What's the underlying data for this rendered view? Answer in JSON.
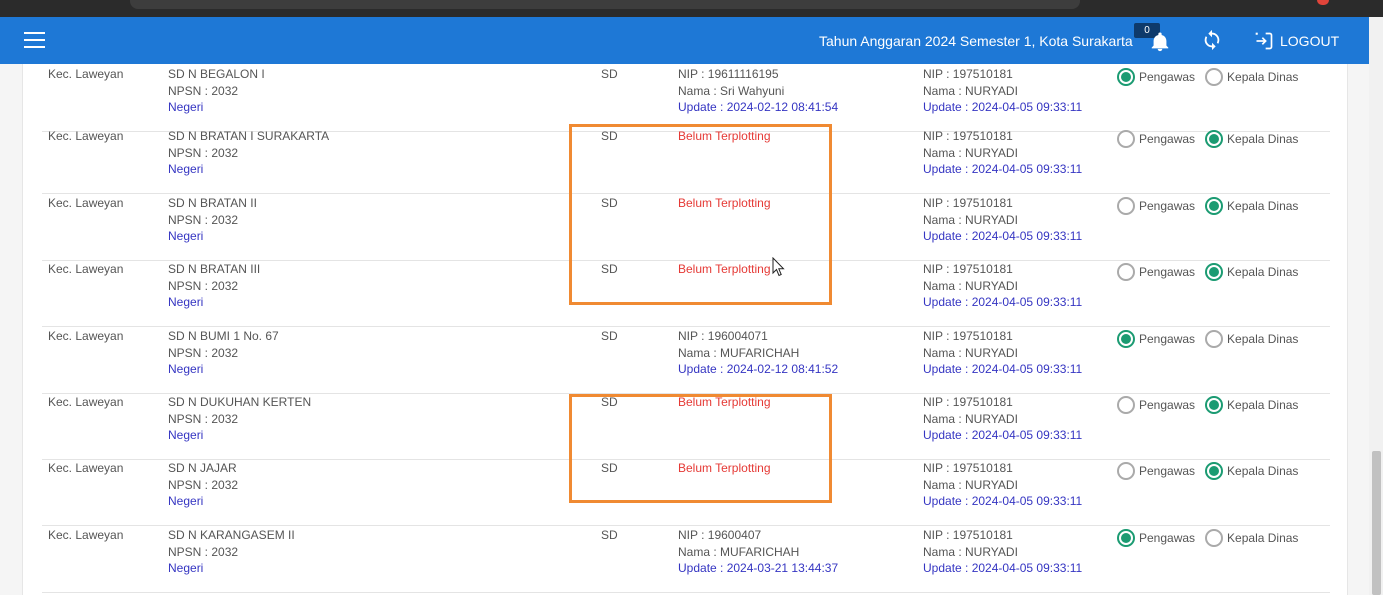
{
  "header": {
    "title": "Tahun Anggaran 2024 Semester 1, Kota Surakarta",
    "notif_count": "0",
    "logout_label": "LOGOUT"
  },
  "radio_labels": {
    "pengawas": "Pengawas",
    "kadis": "Kepala Dinas"
  },
  "rows": [
    {
      "kec": "Kec. Laweyan",
      "school": "SD N BEGALON I",
      "npsn": "NPSN : 2032",
      "status": "Negeri",
      "jenjang": "SD",
      "peng_nip": "NIP : 19611116195",
      "peng_nama": "Nama : Sri Wahyuni",
      "peng_update": "Update : 2024-02-12 08:41:54",
      "kadis_nip": "NIP : 197510181",
      "kadis_nama": "Nama : NURYADI",
      "kadis_update": "Update : 2024-04-05 09:33:11"
    },
    {
      "kec": "Kec. Laweyan",
      "school": "SD N BRATAN I SURAKARTA",
      "npsn": "NPSN : 2032",
      "status": "Negeri",
      "jenjang": "SD",
      "peng_status": "Belum Terplotting",
      "kadis_nip": "NIP : 197510181",
      "kadis_nama": "Nama : NURYADI",
      "kadis_update": "Update : 2024-04-05 09:33:11"
    },
    {
      "kec": "Kec. Laweyan",
      "school": "SD N BRATAN II",
      "npsn": "NPSN : 2032",
      "status": "Negeri",
      "jenjang": "SD",
      "peng_status": "Belum Terplotting",
      "kadis_nip": "NIP : 197510181",
      "kadis_nama": "Nama : NURYADI",
      "kadis_update": "Update : 2024-04-05 09:33:11"
    },
    {
      "kec": "Kec. Laweyan",
      "school": "SD N BRATAN III",
      "npsn": "NPSN : 2032",
      "status": "Negeri",
      "jenjang": "SD",
      "peng_status": "Belum Terplotting",
      "kadis_nip": "NIP : 197510181",
      "kadis_nama": "Nama : NURYADI",
      "kadis_update": "Update : 2024-04-05 09:33:11"
    },
    {
      "kec": "Kec. Laweyan",
      "school": "SD N BUMI 1 No. 67",
      "npsn": "NPSN : 2032",
      "status": "Negeri",
      "jenjang": "SD",
      "peng_nip": "NIP : 196004071",
      "peng_nama": "Nama : MUFARICHAH",
      "peng_update": "Update : 2024-02-12 08:41:52",
      "kadis_nip": "NIP : 197510181",
      "kadis_nama": "Nama : NURYADI",
      "kadis_update": "Update : 2024-04-05 09:33:11"
    },
    {
      "kec": "Kec. Laweyan",
      "school": "SD N DUKUHAN KERTEN",
      "npsn": "NPSN : 2032",
      "status": "Negeri",
      "jenjang": "SD",
      "peng_status": "Belum Terplotting",
      "kadis_nip": "NIP : 197510181",
      "kadis_nama": "Nama : NURYADI",
      "kadis_update": "Update : 2024-04-05 09:33:11"
    },
    {
      "kec": "Kec. Laweyan",
      "school": "SD N JAJAR",
      "npsn": "NPSN : 2032",
      "status": "Negeri",
      "jenjang": "SD",
      "peng_status": "Belum Terplotting",
      "kadis_nip": "NIP : 197510181",
      "kadis_nama": "Nama : NURYADI",
      "kadis_update": "Update : 2024-04-05 09:33:11"
    },
    {
      "kec": "Kec. Laweyan",
      "school": "SD N KARANGASEM II",
      "npsn": "NPSN : 2032",
      "status": "Negeri",
      "jenjang": "SD",
      "peng_nip": "NIP : 19600407",
      "peng_nama": "Nama : MUFARICHAH",
      "peng_update": "Update : 2024-03-21 13:44:37",
      "kadis_nip": "NIP : 197510181",
      "kadis_nama": "Nama : NURYADI",
      "kadis_update": "Update : 2024-04-05 09:33:11"
    }
  ],
  "selection": [
    "pengawas",
    "kadis",
    "kadis",
    "kadis",
    "pengawas",
    "kadis",
    "kadis",
    "pengawas"
  ],
  "colors": {
    "topbar": "#1e78d6",
    "accent": "#1b9b72",
    "link": "#3535c2",
    "warning": "#e53935",
    "highlight": "#f08a32"
  }
}
